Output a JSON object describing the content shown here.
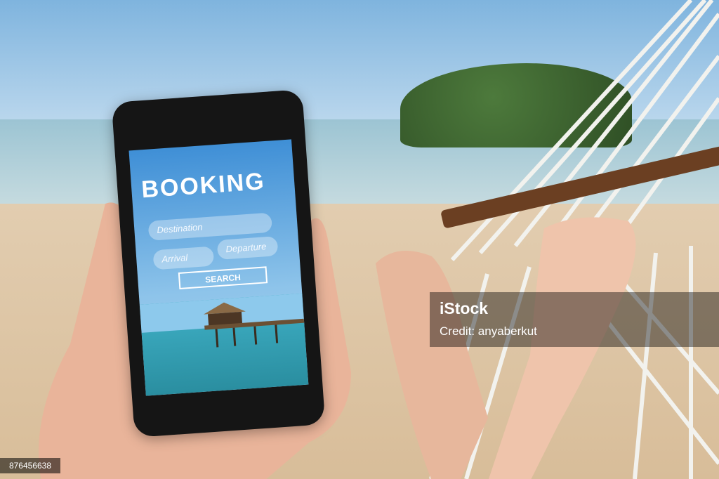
{
  "phone_app": {
    "title": "BOOKING",
    "destination_placeholder": "Destination",
    "arrival_placeholder": "Arrival",
    "departure_placeholder": "Departure",
    "search_label": "SEARCH"
  },
  "watermark": {
    "brand": "iStock",
    "credit": "Credit: anyaberkut"
  },
  "image_id": "876456638",
  "colors": {
    "screen_blue": "#3f8fd6",
    "sand": "#e2cdb0",
    "hammock_wood": "#6b3f22",
    "phone_body": "#151515"
  }
}
